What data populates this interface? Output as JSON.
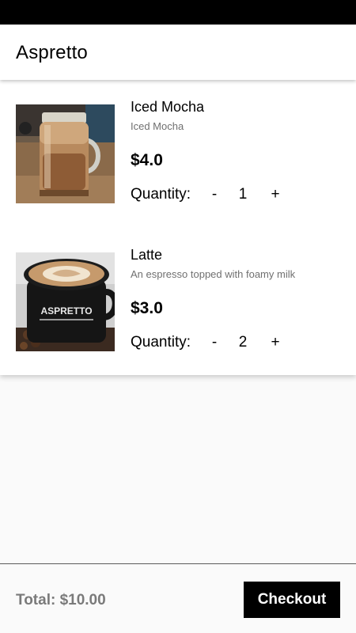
{
  "app": {
    "title": "Aspretto"
  },
  "cart": {
    "quantity_label": "Quantity:",
    "decrement_symbol": "-",
    "increment_symbol": "+",
    "items": [
      {
        "name": "Iced Mocha",
        "description": "Iced Mocha",
        "price": "$4.0",
        "quantity": "1",
        "image_icon": "iced-mocha-image"
      },
      {
        "name": "Latte",
        "description": "An espresso topped with foamy milk",
        "price": "$3.0",
        "quantity": "2",
        "image_icon": "latte-image",
        "mug_text": "ASPRETTO"
      }
    ]
  },
  "footer": {
    "total_label": "Total: $10.00",
    "checkout_label": "Checkout"
  },
  "colors": {
    "status_bar": "#000000",
    "app_bar": "#ffffff",
    "background": "#fafafa",
    "button": "#000000",
    "total_text": "#7a7a7a"
  }
}
